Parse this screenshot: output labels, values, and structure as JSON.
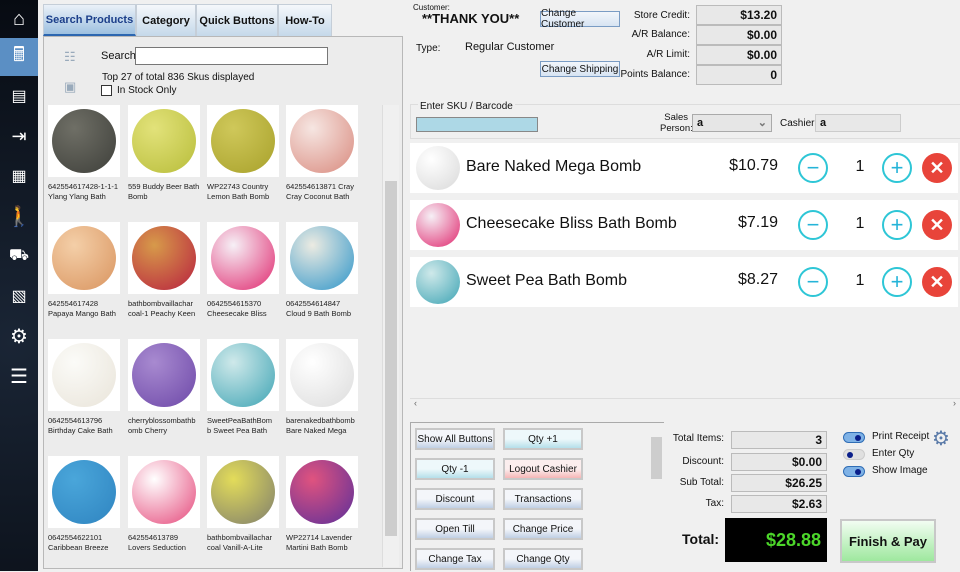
{
  "sidebar": {
    "items": [
      "home-icon",
      "register-icon",
      "invoice-icon",
      "login-icon",
      "inventory-icon",
      "customers-icon",
      "delivery-icon",
      "reports-icon",
      "settings-icon",
      "menu-icon"
    ],
    "active": 1
  },
  "tabs": [
    "Search Products",
    "Category",
    "Quick Buttons",
    "How-To"
  ],
  "search": {
    "label": "Search:",
    "value": "",
    "status": "Top 27 of total 836 Skus displayed",
    "in_stock_label": "In Stock Only"
  },
  "products": [
    {
      "l1": "642554617428-1-1-1",
      "l2": "Ylang Ylang Bath",
      "c1": "#6f6f66",
      "c2": "#3e3f3a"
    },
    {
      "l1": "559 Buddy Beer Bath",
      "l2": "Bomb",
      "c1": "#e2e27a",
      "c2": "#b8bd3a"
    },
    {
      "l1": "WP22743 Country",
      "l2": "Lemon Bath Bomb",
      "c1": "#cfc85a",
      "c2": "#a8a12b"
    },
    {
      "l1": "642554613871 Cray",
      "l2": "Cray Coconut Bath",
      "c1": "#f6e6e2",
      "c2": "#d98a7e"
    },
    {
      "l1": "642554617428",
      "l2": "Papaya Mango Bath",
      "c1": "#f4cfa8",
      "c2": "#d9945f"
    },
    {
      "l1": "bathbombvaillachar",
      "l2": "coal-1 Peachy Keen",
      "c1": "#d79a4a",
      "c2": "#b8203f"
    },
    {
      "l1": "0642554615370",
      "l2": "Cheesecake Bliss",
      "c1": "#f6f0f6",
      "c2": "#e0286e"
    },
    {
      "l1": "0642554614847",
      "l2": "Cloud 9 Bath Bomb",
      "c1": "#ecebe2",
      "c2": "#2e95c9"
    },
    {
      "l1": "0642554613796",
      "l2": "Birthday Cake Bath",
      "c1": "#fbfbf8",
      "c2": "#e9e4d9"
    },
    {
      "l1": "cherryblossombathb",
      "l2": "omb Cherry",
      "c1": "#a88ad0",
      "c2": "#6d48a8"
    },
    {
      "l1": "SweetPeaBathBom",
      "l2": "b Sweet Pea Bath",
      "c1": "#cfe9ea",
      "c2": "#3ea4b4"
    },
    {
      "l1": "barenakedbathbomb",
      "l2": "Bare Naked Mega",
      "c1": "#ffffff",
      "c2": "#dcdcdc"
    },
    {
      "l1": "0642554622101",
      "l2": "Caribbean Breeze",
      "c1": "#4aa6da",
      "c2": "#2f84c0"
    },
    {
      "l1": "642554613789",
      "l2": "Lovers Seduction",
      "c1": "#ffffff",
      "c2": "#e5487a"
    },
    {
      "l1": "bathbombvaillachar",
      "l2": "coal Vanill-A-Lite",
      "c1": "#e3dc5a",
      "c2": "#7f7e6d"
    },
    {
      "l1": "WP22714 Lavender",
      "l2": "Martini Bath Bomb",
      "c1": "#e0537f",
      "c2": "#5b2f9a"
    }
  ],
  "customer": {
    "label": "Customer:",
    "name": "**THANK YOU**",
    "change_customer": "Change Customer",
    "type_label": "Type:",
    "type": "Regular Customer",
    "change_shipping": "Change Shipping"
  },
  "account": {
    "store_credit_label": "Store Credit:",
    "store_credit": "$13.20",
    "ar_balance_label": "A/R Balance:",
    "ar_balance": "$0.00",
    "ar_limit_label": "A/R Limit:",
    "ar_limit": "$0.00",
    "points_label": "Points Balance:",
    "points": "0"
  },
  "sku": {
    "label": "Enter SKU / Barcode",
    "value": "",
    "sales_person_label1": "Sales",
    "sales_person_label2": "Person:",
    "sales_person": "a",
    "cashier_label": "Cashier:",
    "cashier": "a"
  },
  "cart": [
    {
      "name": "Bare Naked Mega Bomb",
      "price": "$10.79",
      "qty": "1",
      "c1": "#ffffff",
      "c2": "#d9d9d9"
    },
    {
      "name": "Cheesecake Bliss  Bath Bomb",
      "price": "$7.19",
      "qty": "1",
      "c1": "#f6f0f6",
      "c2": "#e0286e"
    },
    {
      "name": "Sweet Pea Bath Bomb",
      "price": "$8.27",
      "qty": "1",
      "c1": "#cfe9ea",
      "c2": "#3ea4b4"
    }
  ],
  "quick_buttons": [
    "Show All Buttons",
    "Qty +1",
    "Qty -1",
    "Logout Cashier",
    "Discount",
    "Transactions",
    "Open Till",
    "Change Price",
    "Change Tax",
    "Change Qty"
  ],
  "totals": {
    "items_label": "Total Items:",
    "items": "3",
    "discount_label": "Discount:",
    "discount": "$0.00",
    "subtotal_label": "Sub Total:",
    "subtotal": "$26.25",
    "tax_label": "Tax:",
    "tax": "$2.63",
    "total_label": "Total:",
    "total": "$28.88"
  },
  "options": {
    "print_receipt": "Print Receipt",
    "enter_qty": "Enter Qty",
    "show_image": "Show Image",
    "print_receipt_on": true,
    "enter_qty_on": false,
    "show_image_on": true
  },
  "finish_label": "Finish & Pay"
}
